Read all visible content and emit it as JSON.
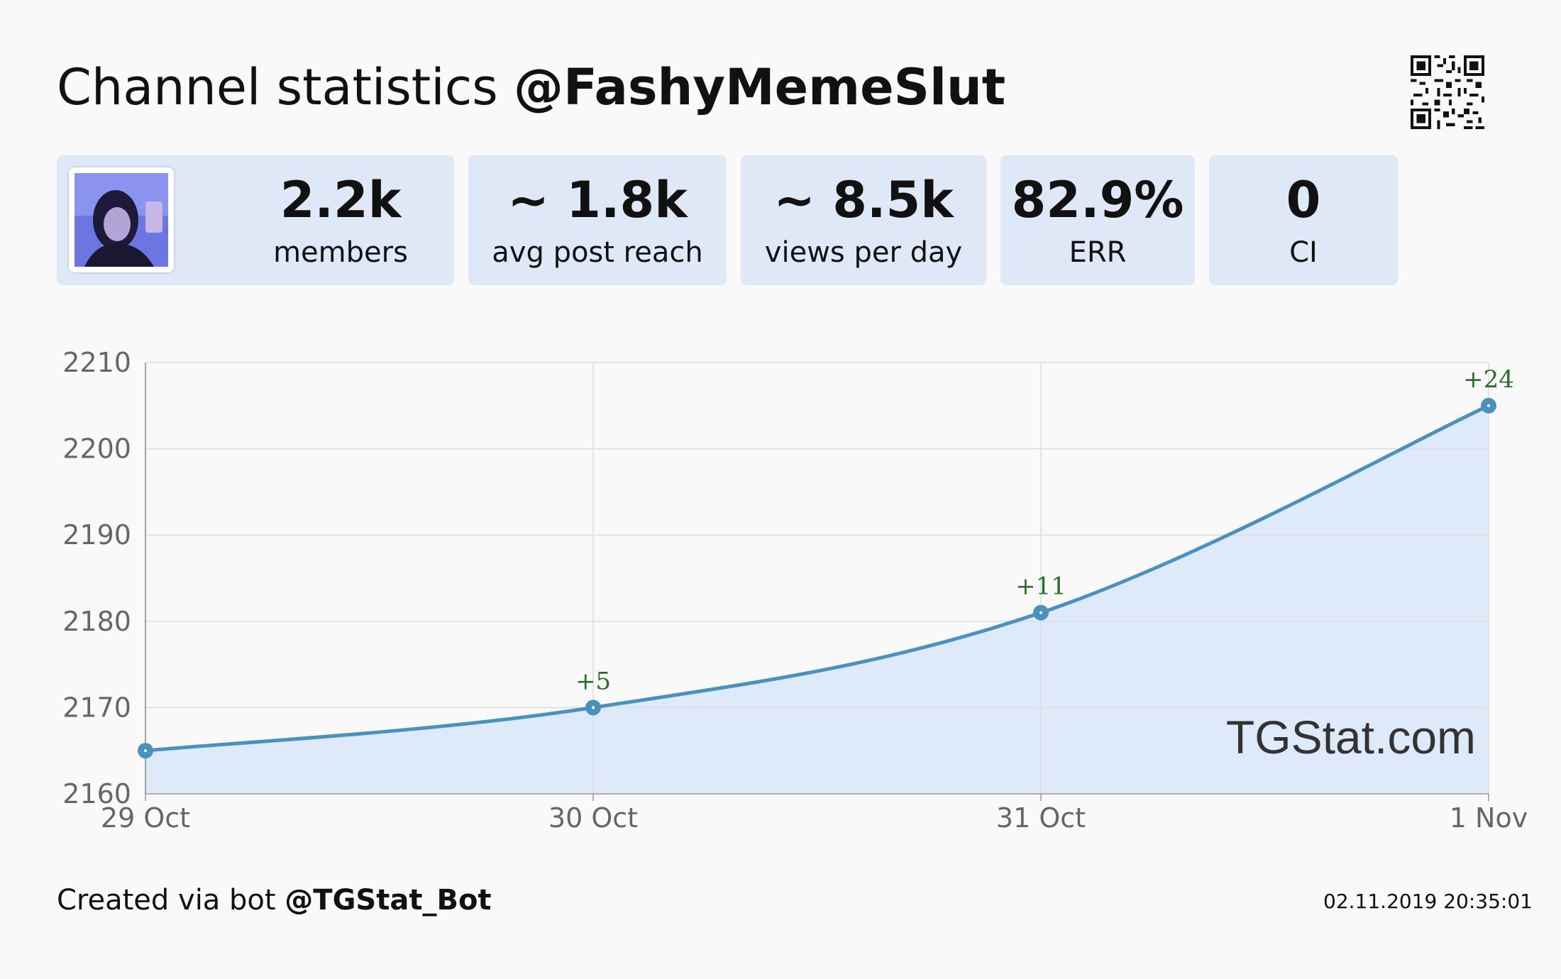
{
  "header": {
    "title_prefix": "Channel statistics",
    "channel_handle": "@FashyMemeSlut",
    "qr_icon": "qr-code-icon"
  },
  "stats": [
    {
      "value": "2.2k",
      "label": "members"
    },
    {
      "value": "~ 1.8k",
      "label": "avg post reach"
    },
    {
      "value": "~ 8.5k",
      "label": "views per day"
    },
    {
      "value": "82.9%",
      "label": "ERR"
    },
    {
      "value": "0",
      "label": "CI"
    }
  ],
  "chart_data": {
    "type": "area",
    "categories": [
      "29 Oct",
      "30 Oct",
      "31 Oct",
      "1 Nov"
    ],
    "series": [
      {
        "values": [
          2165,
          2170,
          2181,
          2205
        ]
      }
    ],
    "data_labels": [
      "",
      "+5",
      "+11",
      "+24"
    ],
    "ylim": [
      2160,
      2210
    ],
    "yticks": [
      2160,
      2170,
      2180,
      2190,
      2200,
      2210
    ],
    "grid": true,
    "watermark": "TGStat.com",
    "colors": {
      "line": "#4a92bd",
      "fill": "#deeafa",
      "label": "#2f6b2a",
      "grid": "#dddddd"
    }
  },
  "footer": {
    "prefix": "Created via bot",
    "bot_handle": "@TGStat_Bot",
    "timestamp": "02.11.2019 20:35:01"
  },
  "colors": {
    "background": "#f9f9f9",
    "card": "#dee8f7"
  }
}
